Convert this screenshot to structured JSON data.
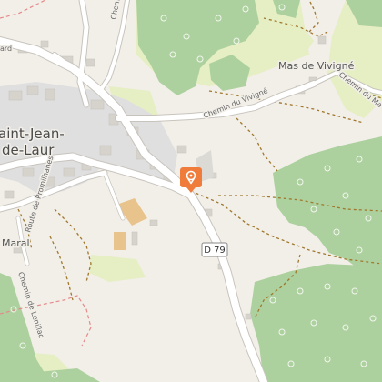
{
  "map": {
    "place_name_line1": "aint-Jean-",
    "place_name_line2": "de-Laur",
    "hamlet_mas": "Mas de Vivigné",
    "hamlet_maral": "Maral",
    "road_chemin_vivigne": "Chemin du Vivigné",
    "road_route_promilhanes": "Route de Promilhanes",
    "road_chemin_lenillac": "Chemin de Lenillac",
    "road_chemin_du_ma": "Chemin du Ma",
    "road_chemin_top": "Chemin",
    "road_top_left": "ard",
    "shield_d79": "D 79",
    "marker_icon": "map-pin-icon",
    "colors": {
      "background": "#f2efe9",
      "forest": "#add19e",
      "meadow": "#e6eec3",
      "road": "#ffffff",
      "road_casing": "#c8c4bd",
      "building": "#d6d3cd",
      "residential": "#e0dfdf",
      "special_building": "#e8c38c",
      "track": "#a0782d",
      "boundary": "#e58a8a",
      "marker": "#f07c3c"
    }
  }
}
